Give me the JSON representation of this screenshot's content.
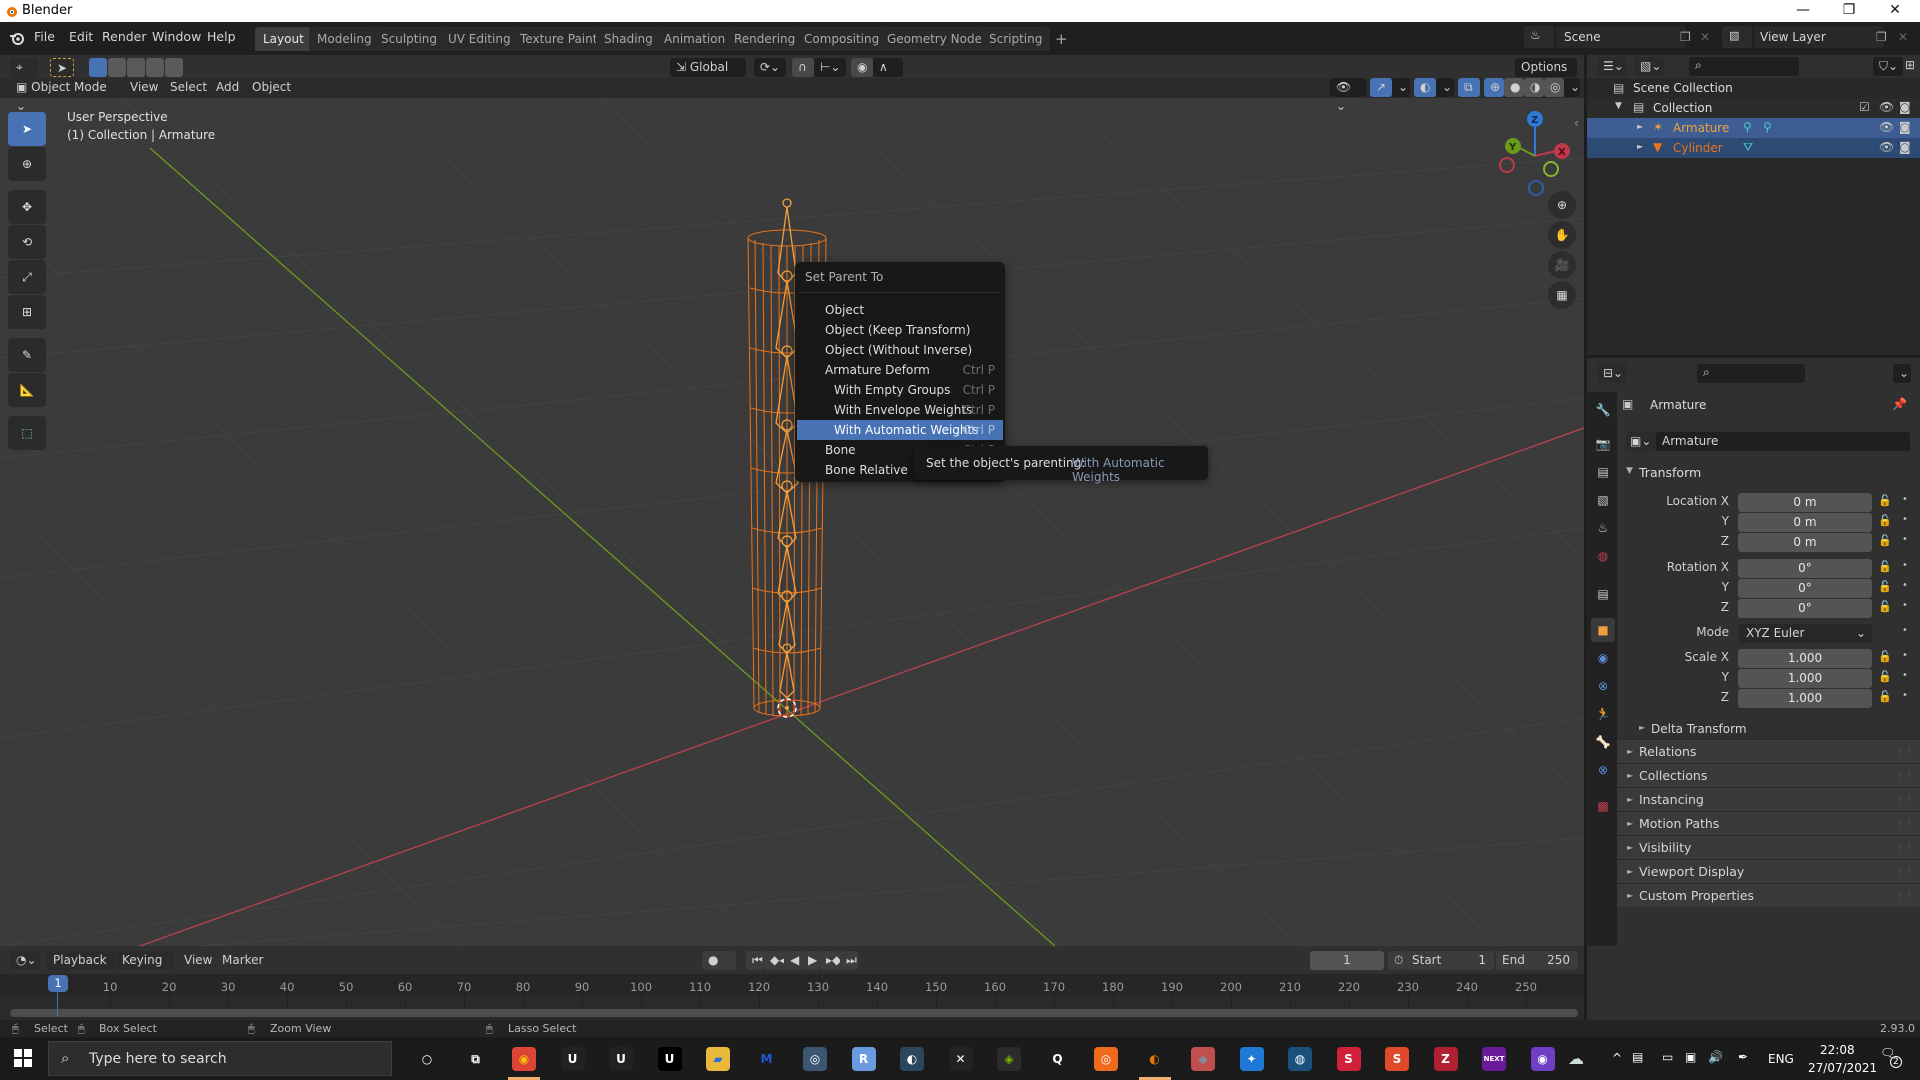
{
  "window": {
    "title": "Blender",
    "minimize": "—",
    "maximize": "❐",
    "close": "✕"
  },
  "menubar": {
    "items": [
      "File",
      "Edit",
      "Render",
      "Window",
      "Help"
    ]
  },
  "workspaces": {
    "tabs": [
      "Layout",
      "Modeling",
      "Sculpting",
      "UV Editing",
      "Texture Paint",
      "Shading",
      "Animation",
      "Rendering",
      "Compositing",
      "Geometry Nodes",
      "Scripting"
    ],
    "active": "Layout",
    "add": "+"
  },
  "scene": {
    "name": "Scene",
    "view_layer": "View Layer"
  },
  "viewport_header": {
    "transform_orientation": "Global",
    "options_label": "Options",
    "mode": "Object Mode",
    "menus": [
      "View",
      "Select",
      "Add",
      "Object"
    ]
  },
  "viewport": {
    "perspective": "User Perspective",
    "context": "(1) Collection | Armature",
    "axes": {
      "x": "X",
      "y": "Y",
      "z": "Z"
    }
  },
  "toolbar": {
    "tools": [
      "select-box",
      "cursor",
      "move",
      "rotate",
      "scale",
      "transform",
      "annotate",
      "measure",
      "add-cube"
    ],
    "active": "select-box"
  },
  "context_menu": {
    "title": "Set Parent To",
    "items": [
      {
        "label": "Object",
        "shortcut": "",
        "sub": false
      },
      {
        "label": "Object (Keep Transform)",
        "shortcut": "",
        "sub": false
      },
      {
        "label": "Object (Without Inverse)",
        "shortcut": "",
        "sub": false
      },
      {
        "label": "Armature Deform",
        "shortcut": "Ctrl P",
        "sub": false
      },
      {
        "label": "With Empty Groups",
        "shortcut": "Ctrl P",
        "sub": true
      },
      {
        "label": "With Envelope Weights",
        "shortcut": "Ctrl P",
        "sub": true
      },
      {
        "label": "With Automatic Weights",
        "shortcut": "Ctrl P",
        "sub": true,
        "highlighted": true
      },
      {
        "label": "Bone",
        "shortcut": "Ctrl P",
        "sub": false
      },
      {
        "label": "Bone Relative",
        "shortcut": "",
        "sub": false
      }
    ]
  },
  "tooltip": {
    "text": "Set the object's parenting:",
    "value": "With Automatic Weights"
  },
  "outliner": {
    "root": "Scene Collection",
    "collection": "Collection",
    "objects": [
      {
        "name": "Armature",
        "type": "armature",
        "selected": true,
        "active": true
      },
      {
        "name": "Cylinder",
        "type": "mesh",
        "selected": true,
        "active": false
      }
    ]
  },
  "properties": {
    "object_name": "Armature",
    "data_name": "Armature",
    "transform_label": "Transform",
    "location": {
      "label": "Location X",
      "x": "0 m",
      "y": "0 m",
      "z": "0 m"
    },
    "rotation": {
      "label": "Rotation X",
      "x": "0°",
      "y": "0°",
      "z": "0°"
    },
    "mode": {
      "label": "Mode",
      "value": "XYZ Euler"
    },
    "scale": {
      "label": "Scale X",
      "x": "1.000",
      "y": "1.000",
      "z": "1.000"
    },
    "axis_labels": {
      "y": "Y",
      "z": "Z"
    },
    "delta_transform": "Delta Transform",
    "panels": [
      "Relations",
      "Collections",
      "Instancing",
      "Motion Paths",
      "Visibility",
      "Viewport Display",
      "Custom Properties"
    ]
  },
  "timeline": {
    "menus": [
      "Playback",
      "Keying",
      "View",
      "Marker"
    ],
    "current_frame": "1",
    "start_label": "Start",
    "start": "1",
    "end_label": "End",
    "end": "250",
    "ticks": [
      "10",
      "20",
      "30",
      "40",
      "50",
      "60",
      "70",
      "80",
      "90",
      "100",
      "110",
      "120",
      "130",
      "140",
      "150",
      "160",
      "170",
      "180",
      "190",
      "200",
      "210",
      "220",
      "230",
      "240",
      "250"
    ],
    "playhead": "1"
  },
  "statusbar": {
    "select": "Select",
    "box_select": "Box Select",
    "zoom_view": "Zoom View",
    "lasso_select": "Lasso Select",
    "version": "2.93.0"
  },
  "taskbar": {
    "search_placeholder": "Type here to search",
    "language": "ENG",
    "time": "22:08",
    "date": "27/07/2021",
    "notifications": "2",
    "apps": [
      "cortana",
      "task-view",
      "chrome",
      "unreal-1",
      "unreal-2",
      "unreal-3",
      "file-explorer",
      "malwarebytes",
      "app-circle",
      "r-app",
      "steam",
      "x-app",
      "nvidia",
      "quixel",
      "houdini",
      "blender",
      "substance-designer-cube",
      "app-blue",
      "app-globe",
      "substance-painter",
      "substance-s",
      "zbrush",
      "next",
      "github"
    ]
  },
  "colors": {
    "accent": "#4772b3",
    "selected_object": "#e8731c",
    "viewport_bg": "#3b3b3b",
    "axis_x": "#c0394b",
    "axis_y": "#6a9b1e",
    "axis_z": "#2f7ad9"
  }
}
